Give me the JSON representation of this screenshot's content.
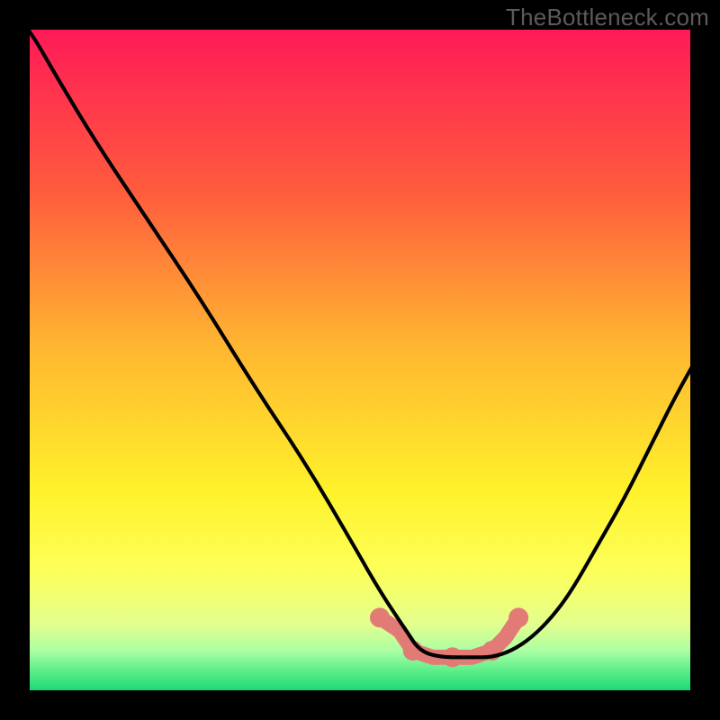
{
  "watermark": "TheBottleneck.com",
  "chart_data": {
    "type": "line",
    "title": "",
    "xlabel": "",
    "ylabel": "",
    "xlim": [
      0,
      100
    ],
    "ylim": [
      0,
      100
    ],
    "background": {
      "type": "vertical_gradient",
      "stops": [
        {
          "pos": 0.0,
          "color": "#ff1a57"
        },
        {
          "pos": 0.24,
          "color": "#ff5a3e"
        },
        {
          "pos": 0.48,
          "color": "#ffb631"
        },
        {
          "pos": 0.7,
          "color": "#fff22b"
        },
        {
          "pos": 0.82,
          "color": "#fdff5a"
        },
        {
          "pos": 0.9,
          "color": "#e3ff8e"
        },
        {
          "pos": 0.94,
          "color": "#abffa3"
        },
        {
          "pos": 0.97,
          "color": "#5eee8a"
        },
        {
          "pos": 1.0,
          "color": "#1cd977"
        }
      ]
    },
    "series": [
      {
        "name": "bottleneck-curve",
        "color": "#000000",
        "stroke_width": 2,
        "x": [
          -5,
          0,
          4,
          10,
          18,
          26,
          34,
          42,
          49,
          53,
          57,
          59,
          62,
          67,
          70,
          73,
          76,
          79,
          82,
          86,
          90,
          94,
          98,
          102
        ],
        "values": [
          106,
          100,
          93,
          83,
          71,
          59,
          46,
          34,
          22,
          15,
          9,
          6,
          5,
          5,
          5,
          6,
          8,
          11,
          15,
          22,
          29,
          37,
          45,
          52
        ]
      }
    ],
    "overlays": [
      {
        "name": "highlight-bottom",
        "type": "blob",
        "color": "#e27b75",
        "points": [
          {
            "x": 53,
            "y": 11
          },
          {
            "x": 56,
            "y": 9
          },
          {
            "x": 58,
            "y": 6
          },
          {
            "x": 61,
            "y": 5
          },
          {
            "x": 64,
            "y": 5
          },
          {
            "x": 67,
            "y": 5
          },
          {
            "x": 70,
            "y": 6
          },
          {
            "x": 72,
            "y": 8
          },
          {
            "x": 74,
            "y": 11
          }
        ]
      }
    ]
  }
}
